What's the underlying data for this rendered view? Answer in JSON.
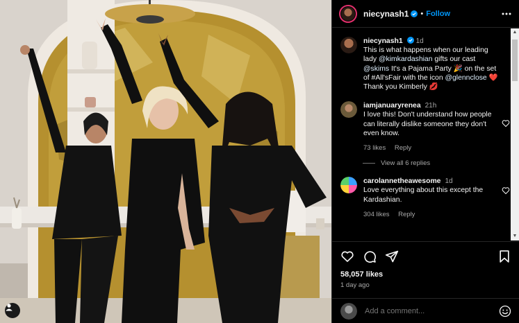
{
  "post": {
    "author": "niecynash1",
    "follow_label": "Follow",
    "dot": "•",
    "caption": {
      "username": "niecynash1",
      "time": "1d",
      "text_parts": [
        "This is what happens when our leading lady ",
        "@kimkardashian",
        " gifts our cast ",
        "@skims",
        " It's a Pajama Party 🎉 on the set of #All'sFair with the icon ",
        "@glennclose",
        " ❤️ Thank you Kimberly 💋"
      ]
    },
    "comments": [
      {
        "username": "iamjanuaryrenea",
        "time": "21h",
        "text": "I love this! Don't understand how people can literally dislike someone they don't even know.",
        "likes": "73 likes",
        "reply": "Reply",
        "view_replies": "View all 6 replies"
      },
      {
        "username": "carolannetheawesome",
        "time": "1d",
        "text": "Love everything about this except the Kardashian.",
        "likes": "304 likes",
        "reply": "Reply"
      }
    ],
    "likes_count": "58,057 likes",
    "date": "1 day ago",
    "add_comment_placeholder": "Add a comment..."
  },
  "icons": {
    "verified": "verified-badge-icon",
    "more": "more-options-icon",
    "like": "heart-icon",
    "comment": "comment-icon",
    "share": "share-icon",
    "save": "bookmark-icon",
    "emoji": "emoji-icon",
    "tagged_user": "user-icon"
  },
  "colors": {
    "accent": "#0095f6",
    "background": "#000000",
    "secondary_text": "#a8a8a8"
  }
}
